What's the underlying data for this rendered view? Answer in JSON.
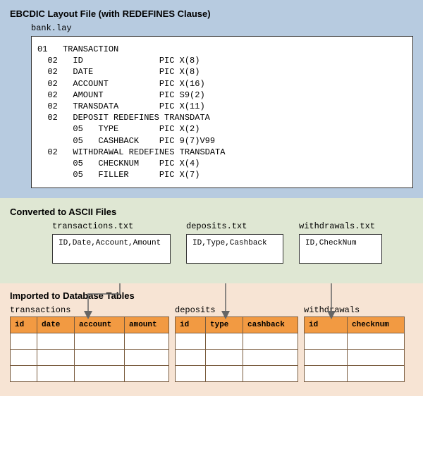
{
  "section1": {
    "title": "EBCDIC Layout File (with REDEFINES Clause)",
    "filename": "bank.lay",
    "code": "01   TRANSACTION\n  02   ID               PIC X(8)\n  02   DATE             PIC X(8)\n  02   ACCOUNT          PIC X(16)\n  02   AMOUNT           PIC S9(2)\n  02   TRANSDATA        PIC X(11)\n  02   DEPOSIT REDEFINES TRANSDATA\n       05   TYPE        PIC X(2)\n       05   CASHBACK    PIC 9(7)V99\n  02   WITHDRAWAL REDEFINES TRANSDATA\n       05   CHECKNUM    PIC X(4)\n       05   FILLER      PIC X(7)"
  },
  "section2": {
    "title": "Converted to ASCII Files",
    "files": [
      {
        "name": "transactions.txt",
        "content": "ID,Date,Account,Amount"
      },
      {
        "name": "deposits.txt",
        "content": "ID,Type,Cashback"
      },
      {
        "name": "withdrawals.txt",
        "content": "ID,CheckNum"
      }
    ]
  },
  "section3": {
    "title": "Imported to Database Tables",
    "tables": [
      {
        "name": "transactions",
        "cols": [
          "id",
          "date",
          "account",
          "amount"
        ]
      },
      {
        "name": "deposits",
        "cols": [
          "id",
          "type",
          "cashback"
        ]
      },
      {
        "name": "withdrawals",
        "cols": [
          "id",
          "checknum"
        ]
      }
    ]
  }
}
